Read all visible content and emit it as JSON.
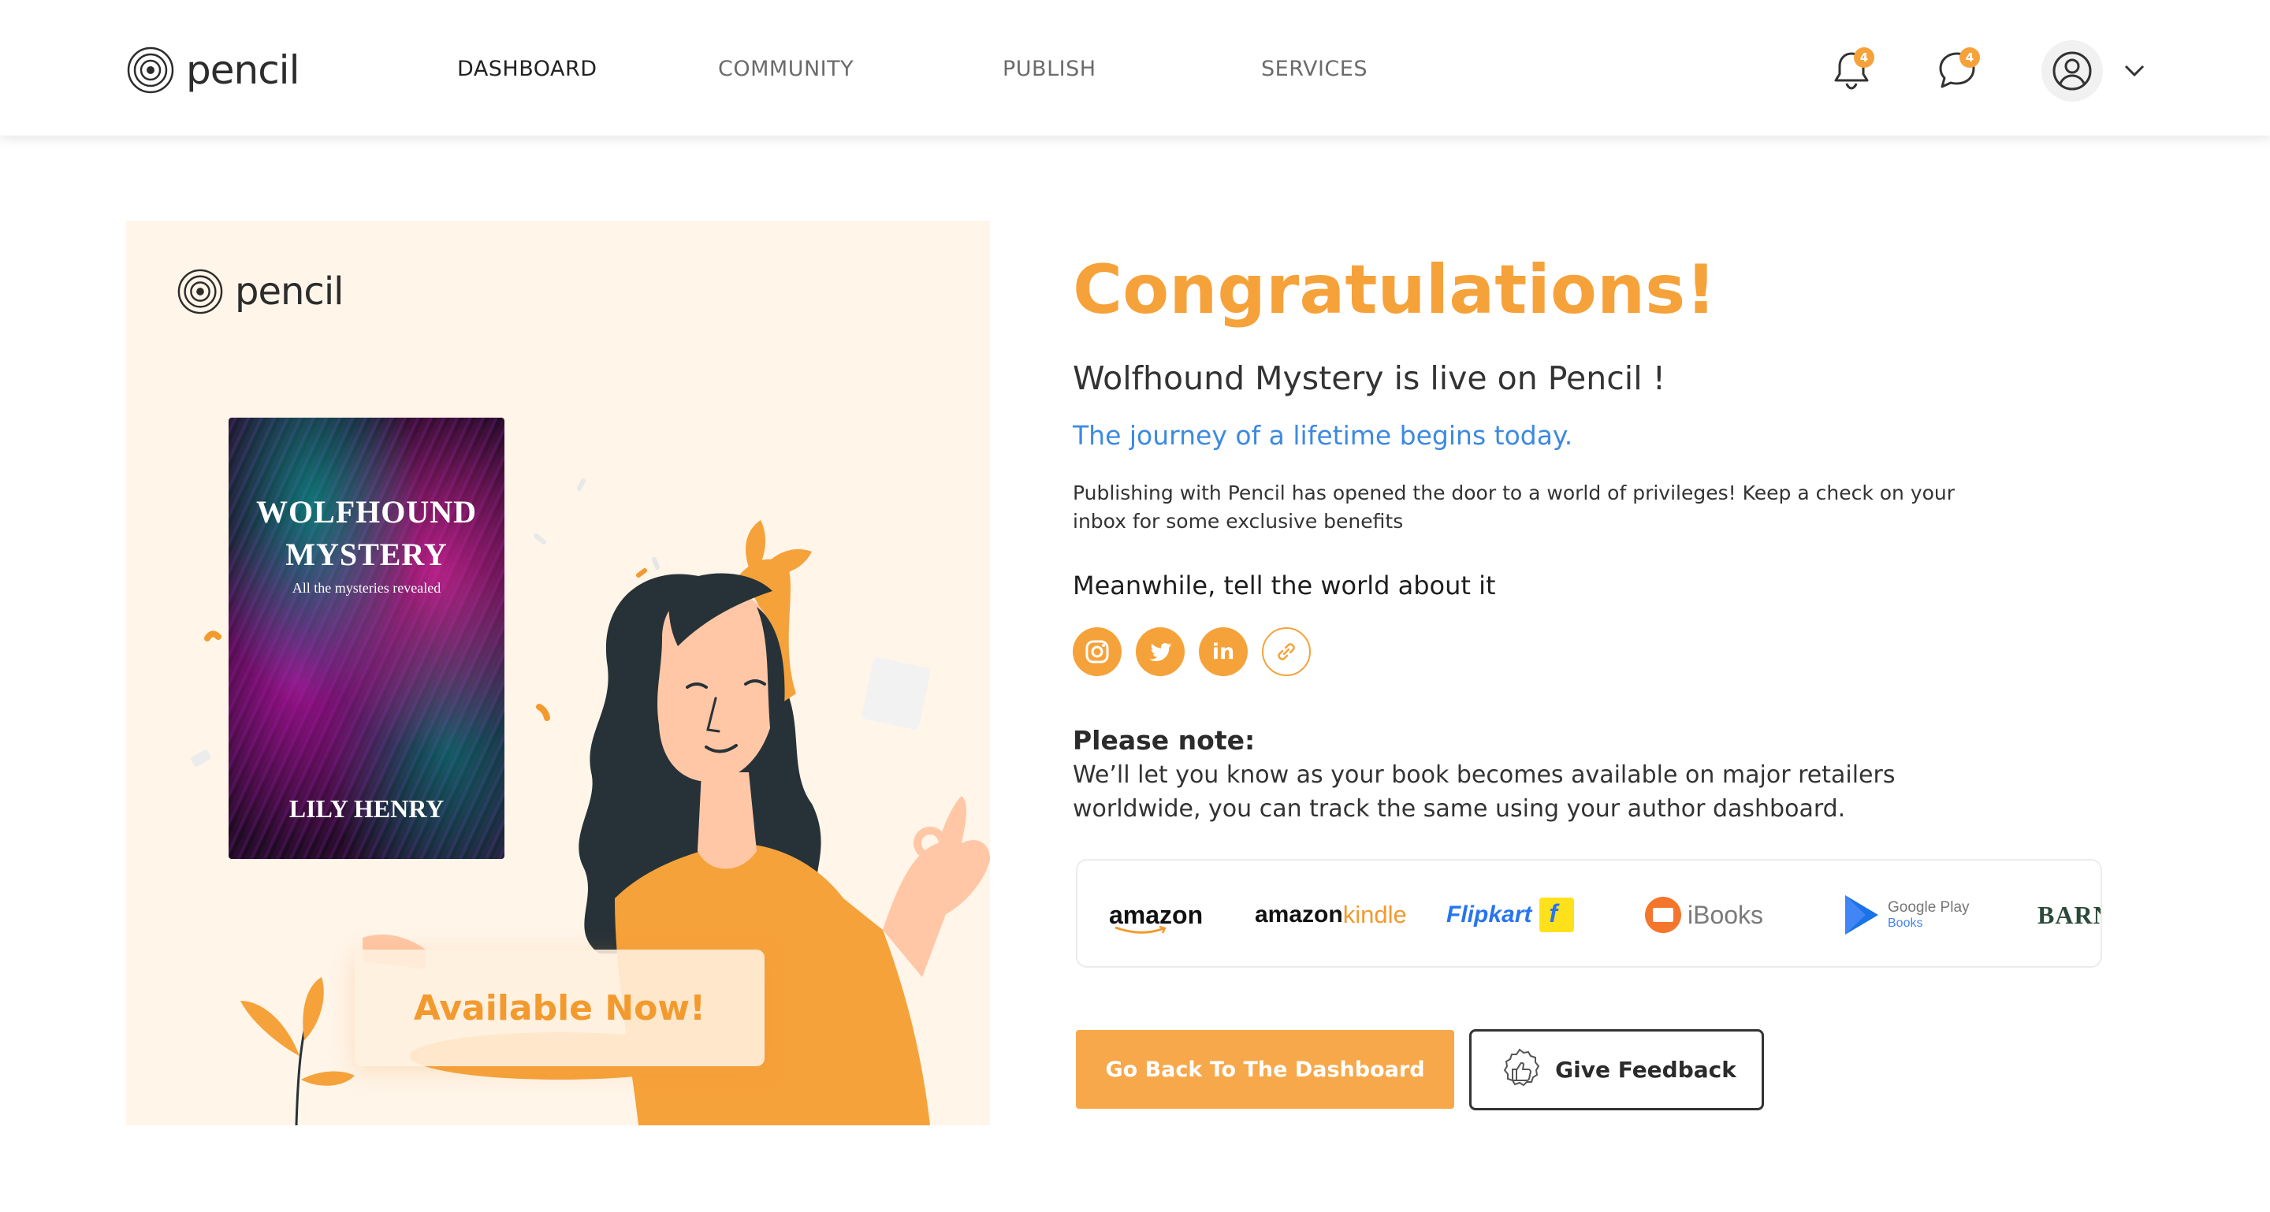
{
  "header": {
    "brand": "pencil",
    "nav": [
      {
        "label": "DASHBOARD",
        "active": true
      },
      {
        "label": "COMMUNITY",
        "active": false
      },
      {
        "label": "PUBLISH",
        "active": false
      },
      {
        "label": "SERVICES",
        "active": false
      }
    ],
    "notifications_count": "4",
    "messages_count": "4",
    "icons": [
      "bell-icon",
      "chat-icon",
      "user-icon",
      "chevron-down-icon"
    ]
  },
  "hero": {
    "brand": "pencil",
    "book": {
      "title_line1": "WOLFHOUND",
      "title_line2": "MYSTERY",
      "subtitle": "All the mysteries revealed",
      "author": "LILY HENRY"
    },
    "badge_text": "Available Now!"
  },
  "main": {
    "heading": "Congratulations!",
    "live_text": "Wolfhound Mystery is live on Pencil !",
    "journey_text": "The journey of a lifetime begins today.",
    "paragraph": "Publishing with Pencil has opened the door to a world of privileges! Keep a check on your inbox for some exclusive benefits",
    "share_heading": "Meanwhile, tell the world about it",
    "social": [
      "instagram-icon",
      "twitter-icon",
      "linkedin-icon",
      "link-icon"
    ],
    "note_heading": "Please note:",
    "note_text": "We’ll let you know as your book becomes available on major retailers worldwide, you can track the same using your author dashboard.",
    "retailers": {
      "amazon": "amazon",
      "amazon_kindle_a": "amazon",
      "amazon_kindle_b": "kindle",
      "flipkart": "Flipkart",
      "ibooks": "iBooks",
      "google_play_a": "Google Play",
      "google_play_b": "Books",
      "barnes": "BARNES"
    },
    "primary_button": "Go Back To The Dashboard",
    "secondary_button": "Give Feedback"
  },
  "colors": {
    "accent": "#f6a23a",
    "link_blue": "#3d8ae0",
    "hero_bg": "#fff5e9"
  }
}
